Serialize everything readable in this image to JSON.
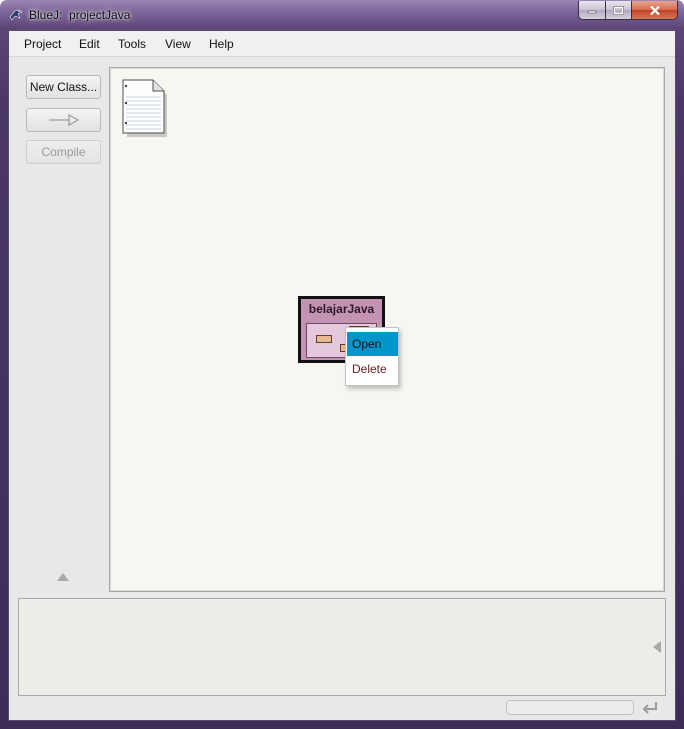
{
  "window": {
    "title": "BlueJ:  projectJava",
    "icon": "bluej-bird-icon"
  },
  "menubar": {
    "items": [
      "Project",
      "Edit",
      "Tools",
      "View",
      "Help"
    ]
  },
  "toolbar": {
    "new_class_label": "New Class...",
    "arrow_icon": "uses-arrow-icon",
    "compile_label": "Compile"
  },
  "canvas": {
    "readme_icon": "readme-document-icon",
    "class": {
      "name": "belajarJava",
      "color": "#c493b3"
    }
  },
  "context_menu": {
    "items": [
      {
        "label": "Open",
        "selected": true
      },
      {
        "label": "Delete",
        "selected": false
      }
    ],
    "selected_color": "#0096c9"
  }
}
